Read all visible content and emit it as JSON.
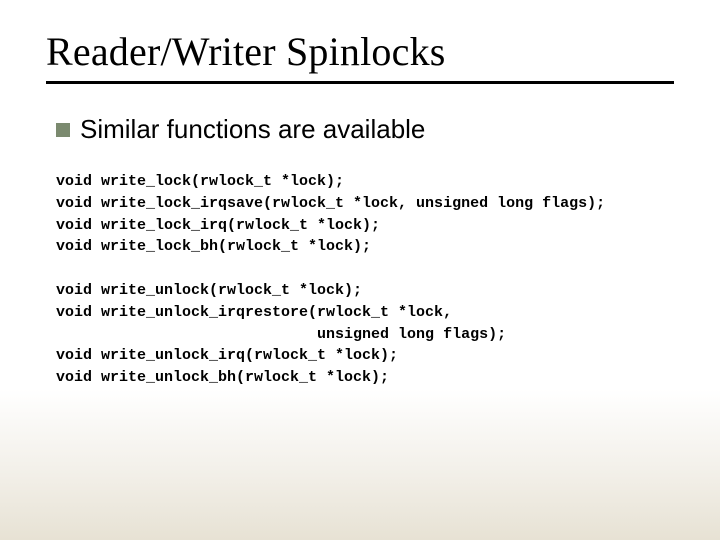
{
  "title": "Reader/Writer Spinlocks",
  "bullet": "Similar functions are available",
  "code1": "void write_lock(rwlock_t *lock);\nvoid write_lock_irqsave(rwlock_t *lock, unsigned long flags);\nvoid write_lock_irq(rwlock_t *lock);\nvoid write_lock_bh(rwlock_t *lock);",
  "code2": "void write_unlock(rwlock_t *lock);\nvoid write_unlock_irqrestore(rwlock_t *lock,\n                             unsigned long flags);\nvoid write_unlock_irq(rwlock_t *lock);\nvoid write_unlock_bh(rwlock_t *lock);"
}
